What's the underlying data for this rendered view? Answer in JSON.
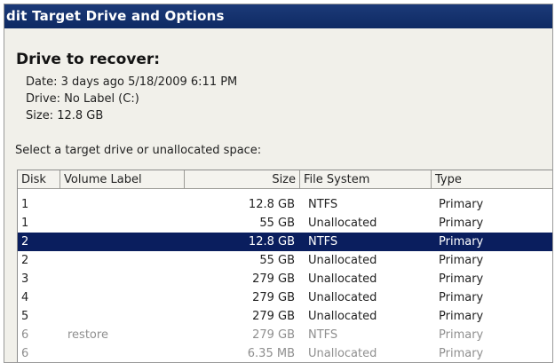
{
  "window": {
    "title": "dit Target Drive and Options"
  },
  "recover": {
    "heading": "Drive to recover:",
    "date": "Date: 3 days ago 5/18/2009 6:11 PM",
    "drive": "Drive: No Label (C:)",
    "size": "Size:  12.8 GB"
  },
  "prompt": "Select a target drive or unallocated space:",
  "table": {
    "columns": [
      "Disk",
      "Volume Label",
      "Size",
      "File System",
      "Type"
    ],
    "rows": [
      {
        "disk": "1",
        "label": "",
        "size": "12.8 GB",
        "fs": "NTFS",
        "type": "Primary"
      },
      {
        "disk": "1",
        "label": "",
        "size": "55 GB",
        "fs": "Unallocated",
        "type": "Primary"
      },
      {
        "disk": "2",
        "label": "",
        "size": "12.8 GB",
        "fs": "NTFS",
        "type": "Primary"
      },
      {
        "disk": "2",
        "label": "",
        "size": "55 GB",
        "fs": "Unallocated",
        "type": "Primary"
      },
      {
        "disk": "3",
        "label": "",
        "size": "279 GB",
        "fs": "Unallocated",
        "type": "Primary"
      },
      {
        "disk": "4",
        "label": "",
        "size": "279 GB",
        "fs": "Unallocated",
        "type": "Primary"
      },
      {
        "disk": "5",
        "label": "",
        "size": "279 GB",
        "fs": "Unallocated",
        "type": "Primary"
      },
      {
        "disk": "6",
        "label": "restore",
        "size": "279 GB",
        "fs": "NTFS",
        "type": "Primary"
      },
      {
        "disk": "6",
        "label": "",
        "size": "6.35 MB",
        "fs": "Unallocated",
        "type": "Primary"
      }
    ],
    "selected_index": 2,
    "faded_indices": [
      7,
      8
    ]
  },
  "colors": {
    "titlebar": "#0e2a63",
    "selection": "#0a1e5e",
    "dialog_bg": "#f1f0ea"
  }
}
